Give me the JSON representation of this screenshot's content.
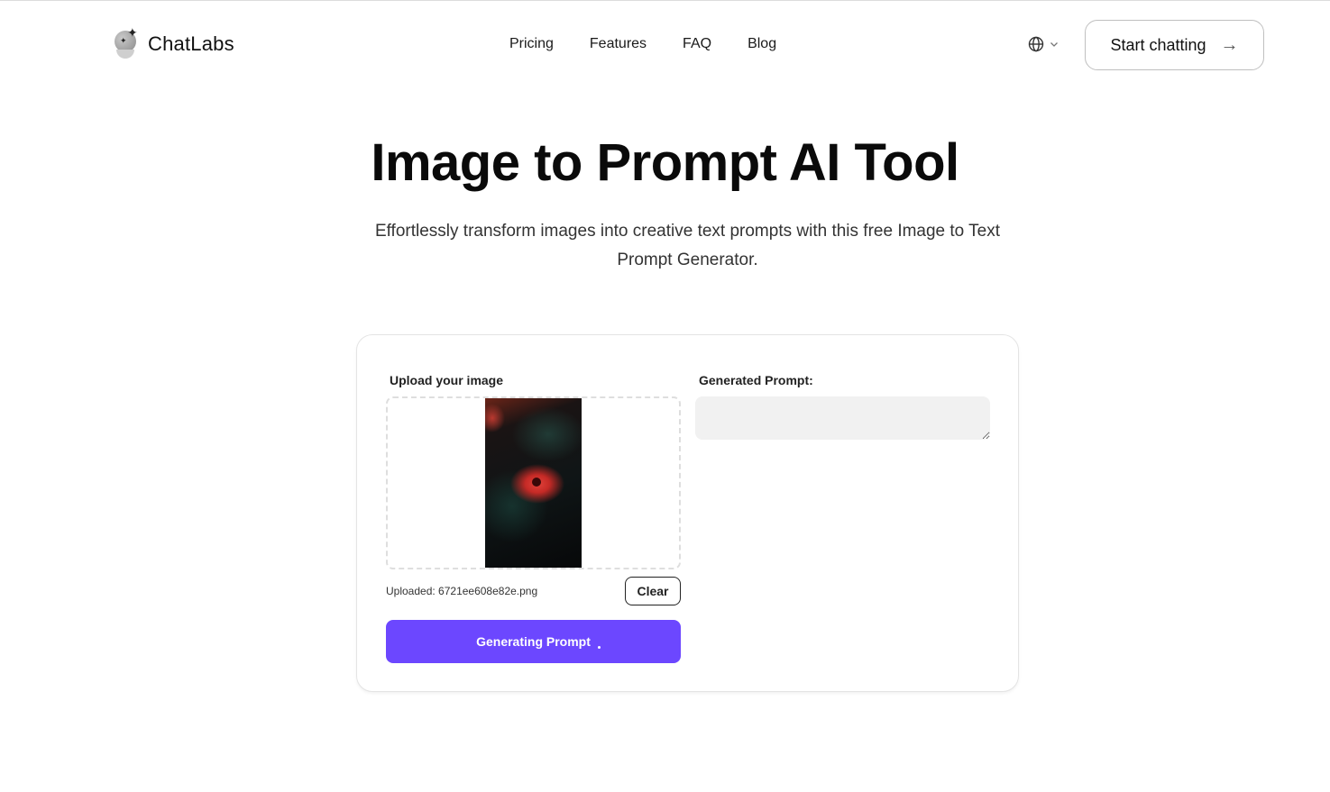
{
  "header": {
    "logo_text": "ChatLabs",
    "nav": [
      {
        "label": "Pricing"
      },
      {
        "label": "Features"
      },
      {
        "label": "FAQ"
      },
      {
        "label": "Blog"
      }
    ],
    "language_icon": "globe-icon",
    "start_button": {
      "label": "Start chatting",
      "icon": "arrow-right-icon"
    }
  },
  "hero": {
    "title": "Image to Prompt AI Tool",
    "subtitle": "Effortlessly transform images into creative text prompts with this free Image to Text Prompt Generator."
  },
  "tool": {
    "upload_label": "Upload your image",
    "uploaded_text": "Uploaded: 6721ee608e82e.png",
    "clear_label": "Clear",
    "generate_label": "Generating Prompt",
    "generated_label": "Generated Prompt:",
    "generated_value": "",
    "colors": {
      "accent": "#6c47ff"
    }
  }
}
